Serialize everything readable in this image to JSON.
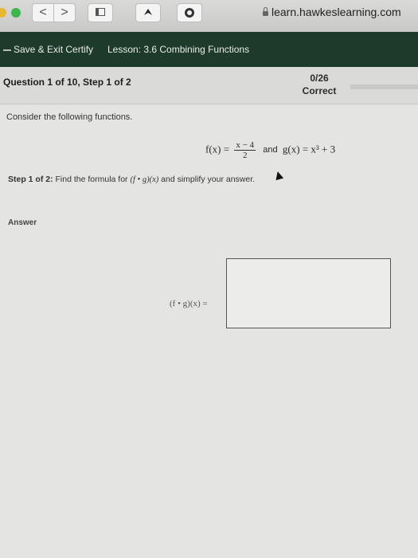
{
  "browser": {
    "back_glyph": "<",
    "forward_glyph": ">",
    "url": "learn.hawkeslearning.com"
  },
  "appbar": {
    "save_exit": "Save & Exit Certify",
    "lesson": "Lesson: 3.6 Combining Functions"
  },
  "question": {
    "title": "Question 1 of 10, Step 1 of 2",
    "score": "0/26",
    "score_label": "Correct"
  },
  "content": {
    "prompt": "Consider the following functions.",
    "f_lhs": "f(x) =",
    "f_num": "x − 4",
    "f_den": "2",
    "and_text": "and",
    "g_def": "g(x) = x³ + 3",
    "step_label": "Step 1 of 2:",
    "step_text": "Find the formula for",
    "step_expr": "(f • g)(x)",
    "step_tail": "and simplify your answer.",
    "answer_label": "Answer",
    "expr_label": "(f • g)(x) ="
  },
  "colors": {
    "appbar_bg": "#1e3a2a",
    "page_bg": "#e4e4e2"
  }
}
